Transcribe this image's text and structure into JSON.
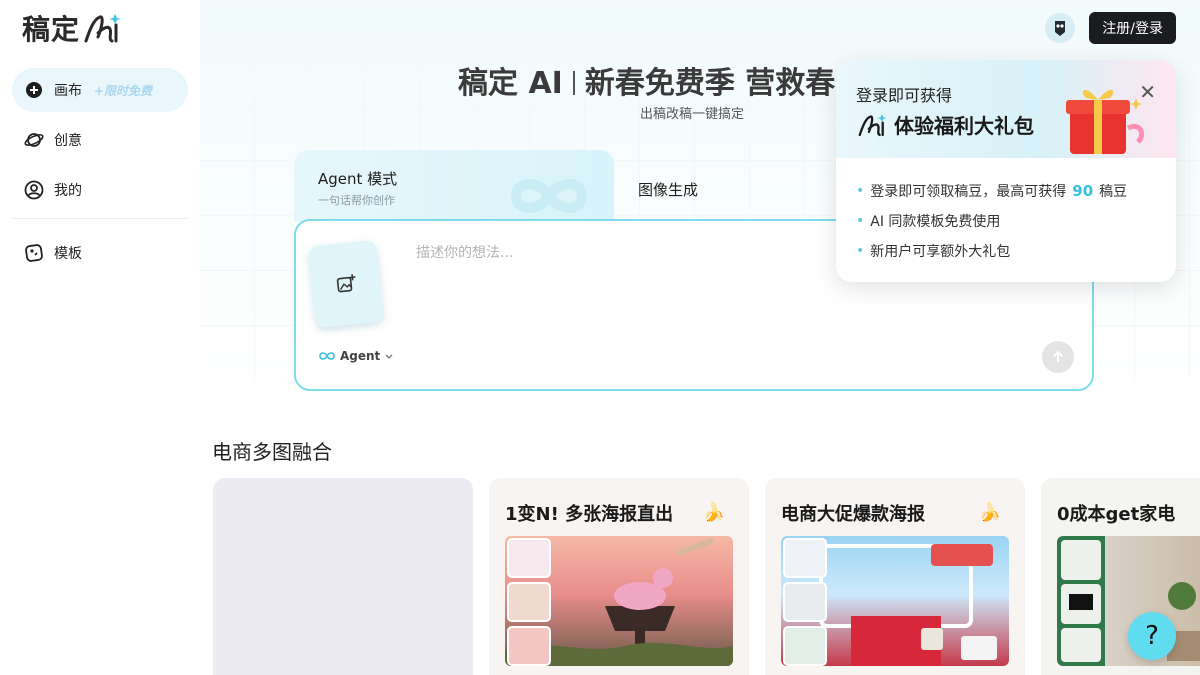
{
  "brand": {
    "logo_text": "稿定"
  },
  "sidebar": {
    "items": [
      {
        "label": "画布",
        "badge": "+限时免费",
        "icon": "plus-circle-icon",
        "active": true
      },
      {
        "label": "创意",
        "icon": "planet-icon"
      },
      {
        "label": "我的",
        "icon": "user-circle-icon"
      },
      {
        "label": "模板",
        "icon": "template-icon"
      }
    ]
  },
  "header": {
    "login_label": "注册/登录",
    "avatar_icon": "mascot-avatar-icon"
  },
  "hero": {
    "title_brand": "稿定 AI",
    "title_text": "新春免费季 营救春",
    "subtitle": "出稿改稿一键搞定"
  },
  "editor": {
    "tab_agent_title": "Agent 模式",
    "tab_agent_sub": "一句话帮你创作",
    "tab_image_title": "图像生成",
    "placeholder": "描述你的想法...",
    "agent_label": "Agent"
  },
  "section": {
    "title": "电商多图融合",
    "cards": [
      {
        "title": ""
      },
      {
        "title": "1变N! 多张海报直出"
      },
      {
        "title": "电商大促爆款海报"
      },
      {
        "title": "0成本get家电"
      }
    ]
  },
  "popup": {
    "line1": "登录即可获得",
    "line2": "体验福利大礼包",
    "benefits": [
      {
        "pre": "登录即可领取稿豆，最高可获得",
        "num": "90",
        "post": "稿豆"
      },
      {
        "text": "AI 同款模板免费使用"
      },
      {
        "text": "新用户可享额外大礼包"
      }
    ]
  },
  "help": {
    "label": "?"
  },
  "colors": {
    "accent": "#5fdcef",
    "editor_border": "#7fdcea",
    "login_bg": "#1b1c1f"
  }
}
